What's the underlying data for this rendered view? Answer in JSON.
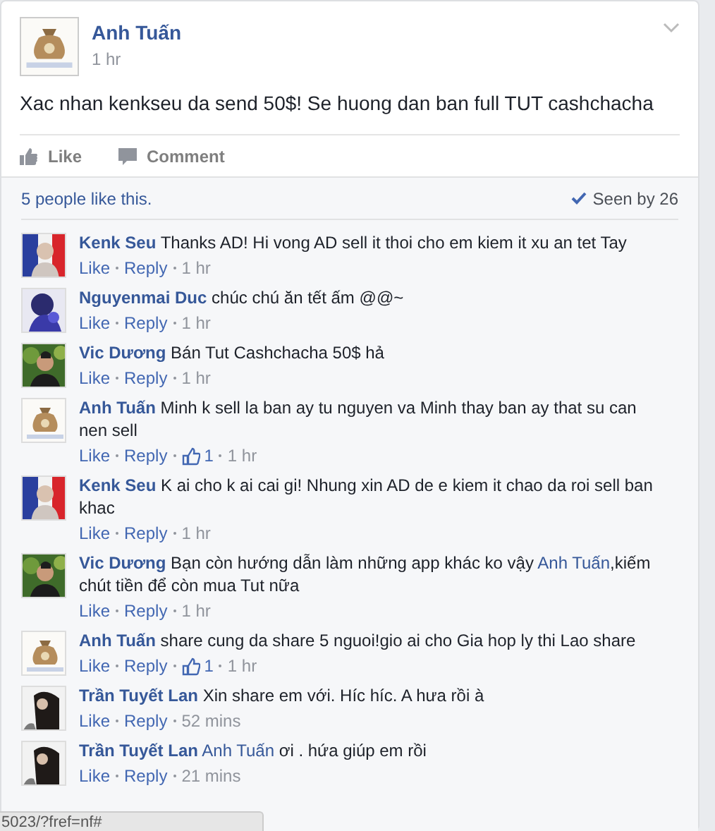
{
  "post": {
    "author": "Anh Tuấn",
    "time": "1 hr",
    "text": "Xac nhan kenkseu da send 50$! Se huong dan ban full TUT cashchacha"
  },
  "actions": [
    "Like",
    "Comment"
  ],
  "likes_summary": "5 people like this.",
  "seen": "Seen by 26",
  "comments": [
    {
      "author": "Kenk Seu",
      "parts": [
        {
          "kind": "text",
          "text": "Thanks AD! Hi vong AD sell it thoi cho em kiem it xu an tet Tay"
        }
      ],
      "like": "Like",
      "reply": "Reply",
      "time": "1 hr"
    },
    {
      "author": "Nguyenmai Duc",
      "parts": [
        {
          "kind": "text",
          "text": "chúc chú ăn tết ấm @@~"
        }
      ],
      "like": "Like",
      "reply": "Reply",
      "time": "1 hr"
    },
    {
      "author": "Vic Dương",
      "parts": [
        {
          "kind": "text",
          "text": "Bán Tut Cashchacha 50$ hả"
        }
      ],
      "like": "Like",
      "reply": "Reply",
      "time": "1 hr"
    },
    {
      "author": "Anh Tuấn",
      "parts": [
        {
          "kind": "text",
          "text": "Minh k sell la ban ay tu nguyen va Minh thay ban ay that su can nen sell"
        }
      ],
      "like": "Like",
      "reply": "Reply",
      "likes": "1",
      "time": "1 hr"
    },
    {
      "author": "Kenk Seu",
      "parts": [
        {
          "kind": "text",
          "text": "K ai cho k ai cai gi! Nhung xin AD de e kiem it chao da roi sell ban khac"
        }
      ],
      "like": "Like",
      "reply": "Reply",
      "time": "1 hr"
    },
    {
      "author": "Vic Dương",
      "parts": [
        {
          "kind": "text",
          "text": "Bạn còn hướng dẫn làm những app khác ko vậy "
        },
        {
          "kind": "mention",
          "text": "Anh Tuấn"
        },
        {
          "kind": "text",
          "text": ",kiếm chút tiền để còn mua Tut nữa"
        }
      ],
      "like": "Like",
      "reply": "Reply",
      "time": "1 hr"
    },
    {
      "author": "Anh Tuấn",
      "parts": [
        {
          "kind": "text",
          "text": "share cung da share 5 nguoi!gio ai cho Gia hop ly thi Lao share"
        }
      ],
      "like": "Like",
      "reply": "Reply",
      "likes": "1",
      "time": "1 hr"
    },
    {
      "author": "Trần Tuyết Lan",
      "parts": [
        {
          "kind": "text",
          "text": "Xin share em với. Híc híc. A hưa rồi à"
        }
      ],
      "like": "Like",
      "reply": "Reply",
      "time": "52 mins"
    },
    {
      "author": "Trần Tuyết Lan",
      "parts": [
        {
          "kind": "mention",
          "text": "Anh Tuấn"
        },
        {
          "kind": "text",
          "text": " ơi . hứa giúp em rồi"
        }
      ],
      "like": "Like",
      "reply": "Reply",
      "time": "21 mins"
    }
  ],
  "status_url": "5023/?fref=nf#"
}
